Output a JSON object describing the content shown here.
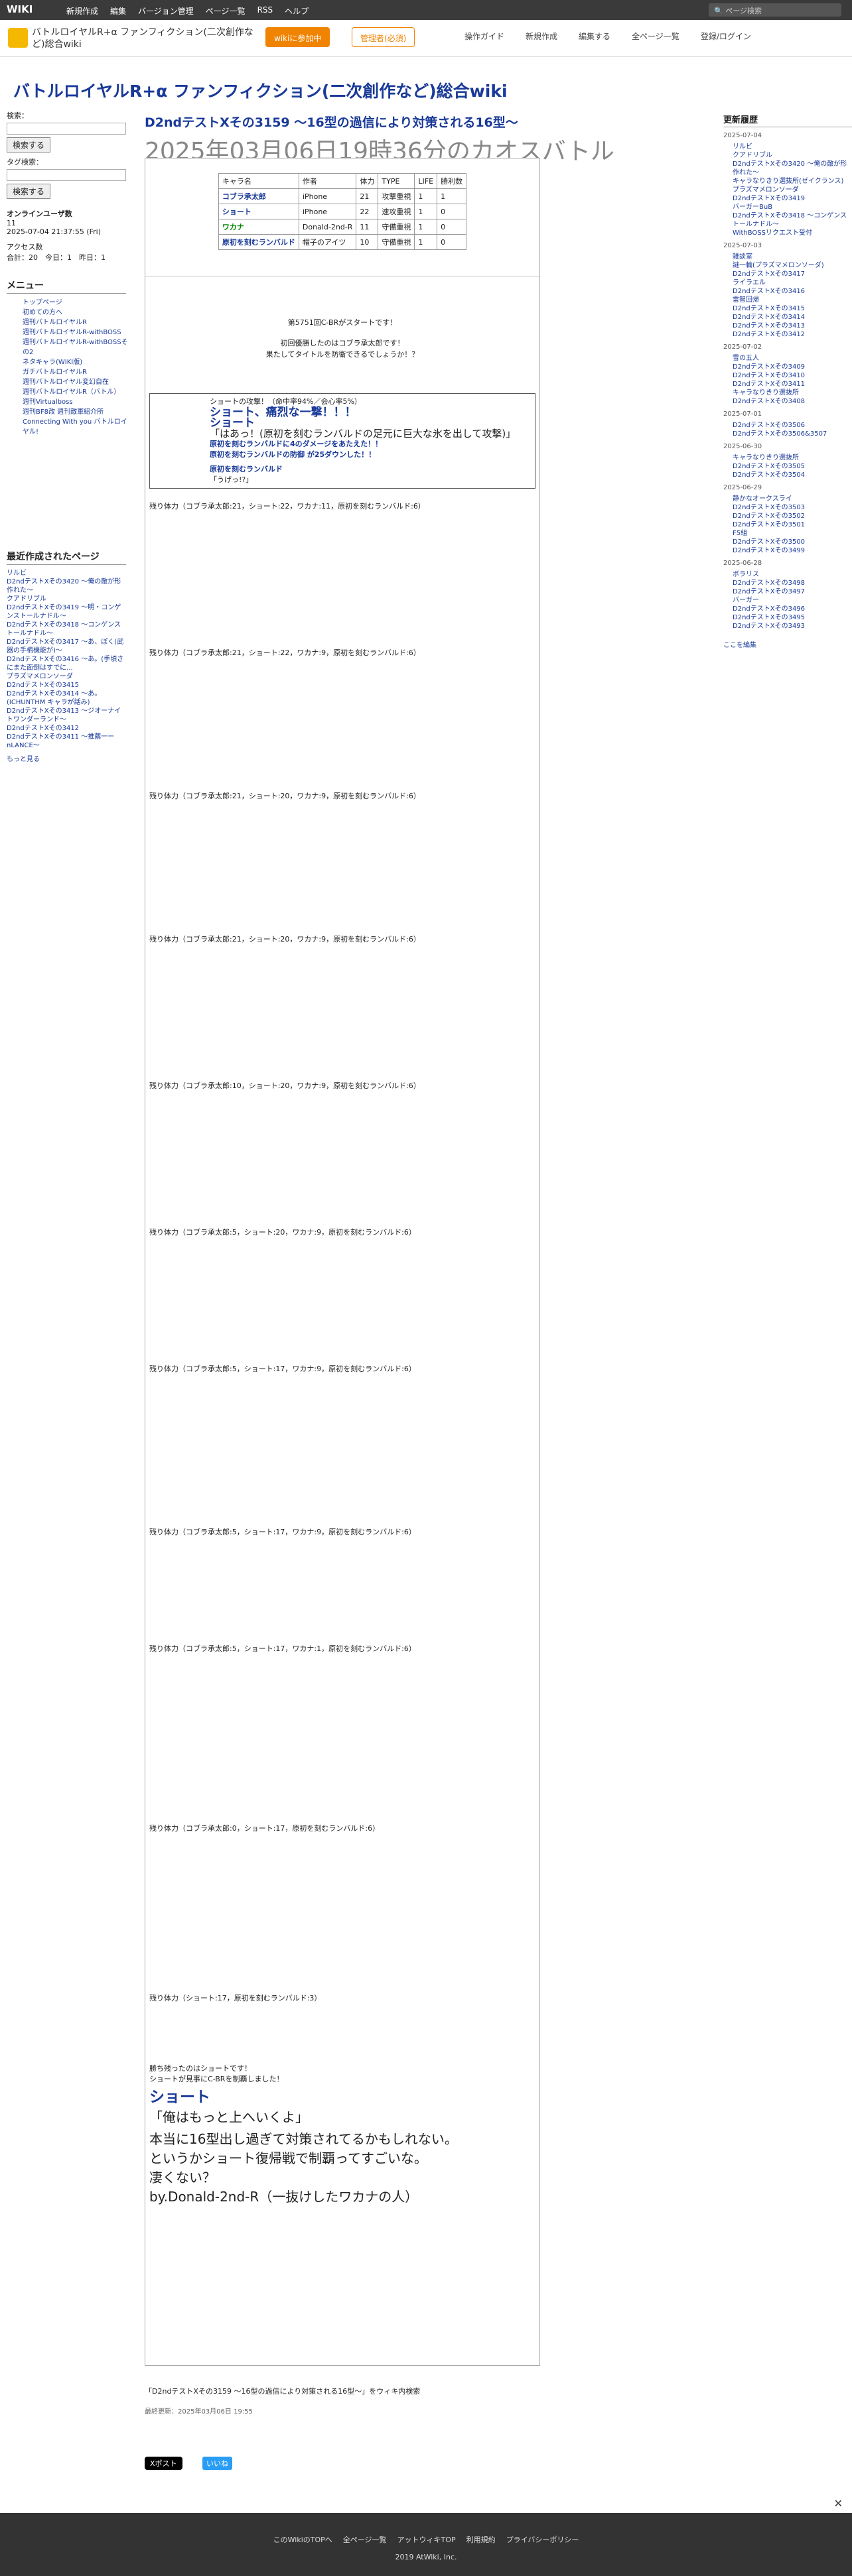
{
  "topbar": {
    "logo": "WIKI",
    "menu": [
      "新規作成",
      "編集",
      "バージョン管理",
      "ページ一覧",
      "RSS",
      "ヘルプ"
    ],
    "search_placeholder": "ページ検索"
  },
  "header": {
    "site_title": "バトルロイヤルR+α ファンフィクション(二次創作など)総合wiki",
    "btn1": "wikiに参加中",
    "btn2": "管理者(必須)",
    "icons": [
      "操作ガイド",
      "新規作成",
      "編集する",
      "全ページ一覧",
      "登録/ログイン"
    ]
  },
  "page_title": "バトルロイヤルR+α ファンフィクション(二次創作など)総合wiki",
  "left": {
    "search_label": "検索：",
    "search_btn": "検索する",
    "tag_label": "タグ検索：",
    "tag_btn": "検索する",
    "online": "オンラインユーザ数",
    "online_count": "11",
    "time": "2025-07-04 21:37:55 (Fri)",
    "access": "アクセス数",
    "access_vals": "合計：20　今日：1　昨日：1",
    "menu_title": "メニュー",
    "recent_title": "最近作成されたページ",
    "more": "もっと見る",
    "menu_items": [
      "トップページ",
      "初めての方へ",
      "週刊バトルロイヤルR",
      "週刊バトルロイヤルR-withBOSS",
      "週刊バトルロイヤルR-withBOSSその2",
      "ネタキャラ(WIKI版)",
      "ガチバトルロイヤルR",
      "週刊バトルロイヤル変幻自在",
      "週刊バトルロイヤルR（バトル）",
      "週刊Virtualboss",
      "週刊BF8改 週刊敵軍紹介所",
      "Connecting With you バトルロイヤル!"
    ],
    "recent": [
      "リルビ",
      "D2ndテストXその3420 ～俺の敵が形作れた～",
      "クアドリブル",
      "D2ndテストXその3419 ～明・コンゲンストールナドル～",
      "D2ndテストXその3418 ～コンゲンストールナドル～",
      "D2ndテストXその3417 ～あ、ぽく(武器の手柄機能が)～",
      "D2ndテストXその3416 ～あ。(手頃さにまた面倒はすでに...",
      "プラズマメロンソーダ",
      "D2ndテストXその3415",
      "D2ndテストXその3414 ～あ。(ICHUNTHM キャラが話み)",
      "D2ndテストXその3413 ～ジオーナイトワンダーランド～",
      "D2ndテストXその3412",
      "D2ndテストXその3411 ～推薦一ーnLANCE～"
    ]
  },
  "main": {
    "h2": "D2ndテストXその3159 ～16型の過信により対策される16型～",
    "date": "2025年03月06日19時36分のカオスバトル"
  },
  "table": {
    "headers": [
      "キャラ名",
      "作者",
      "体力",
      "TYPE",
      "LIFE",
      "勝利数"
    ],
    "rows": [
      [
        "コブラ承太郎",
        "iPhone",
        "21",
        "攻撃重視",
        "1",
        "1"
      ],
      [
        "ショート",
        "iPhone",
        "22",
        "速攻重視",
        "1",
        "0"
      ],
      [
        "ワカナ",
        "Donald-2nd-R",
        "11",
        "守備重視",
        "1",
        "0"
      ],
      [
        "原初を刻むランバルド",
        "帽子のアイツ",
        "10",
        "守備重視",
        "1",
        "0"
      ]
    ]
  },
  "story": {
    "start_count": "第5751回C-BRがスタートです！",
    "start1": "初回優勝したのはコブラ承太郎です！",
    "start2": "果たしてタイトルを防衛できるでしょうか！？",
    "t1_attack": "ショートの攻撃！（命中率94%／会心率5%）",
    "t1_big": "ショート、痛烈な一撃！！！",
    "t1_name": "ショート",
    "t1_line": "「はあっ！(原初を刻むランバルドの足元に巨大な氷を出して攻撃)」",
    "t1_dmg": "原初を刻むランバルドに4のダメージをあたえた！！",
    "t1_dmg2": "原初を刻むランバルドの防御 が25ダウンした！！",
    "t1_rname": "原初を刻むランバルド",
    "t1_rline": "「うげっ!?」",
    "hp1": "残り体力（コブラ承太郎:21，ショート:22，ワカナ:11，原初を刻むランバルド:6）",
    "last_win": "勝ち残ったのはショートです！",
    "last_rank": "ショートが見事にC-BRを制覇しました！",
    "last_name": "ショート",
    "last_line": "「俺はもっと上へいくよ」",
    "c1": "本当に16型出し過ぎて対策されてるかもしれない。",
    "c2": "というかショート復帰戦で制覇ってすごいな。",
    "c3": "凄くない？",
    "c4": "by.Donald-2nd-R（一抜けしたワカナの人）"
  },
  "hp_lines": [
    "残り体力（コブラ承太郎:21，ショート:22，ワカナ:9，原初を刻むランバルド:6）",
    "残り体力（コブラ承太郎:21，ショート:20，ワカナ:9，原初を刻むランバルド:6）",
    "残り体力（コブラ承太郎:21，ショート:20，ワカナ:9，原初を刻むランバルド:6）",
    "残り体力（コブラ承太郎:10，ショート:20，ワカナ:9，原初を刻むランバルド:6）",
    "残り体力（コブラ承太郎:5，ショート:20，ワカナ:9，原初を刻むランバルド:6）",
    "残り体力（コブラ承太郎:5，ショート:17，ワカナ:9，原初を刻むランバルド:6）",
    "残り体力（コブラ承太郎:5，ショート:17，ワカナ:9，原初を刻むランバルド:6）",
    "残り体力（コブラ承太郎:5，ショート:17，ワカナ:1，原初を刻むランバルド:6）",
    "残り体力（コブラ承太郎:0，ショート:17，原初を刻むランバルド:6）",
    "残り体力（ショート:17，原初を刻むランバルド:3）"
  ],
  "bottom": {
    "tweet": "Xポスト",
    "like": "いいね",
    "link": "「D2ndテストXその3159 ～16型の過信により対策される16型～」をウィキ内検索",
    "updated": "最終更新：2025年03月06日 19:55"
  },
  "right": {
    "title": "更新履歴",
    "groups": [
      {
        "date": "2025-07-04",
        "items": [
          "リルビ",
          "クアドリブル",
          "D2ndテストXその3420 ～俺の敵が形作れた～",
          "キャラなりきり選抜所(ゼイクランス)",
          "プラズマメロンソーダ",
          "D2ndテストXその3419",
          "バーガーBuB",
          "D2ndテストXその3418 ～コンゲンストールナドル～",
          "WithBOSSリクエスト受付"
        ]
      },
      {
        "date": "2025-07-03",
        "items": [
          "雑談室",
          "謎一輪(プラズマメロンソーダ)",
          "D2ndテストXその3417",
          "ライラエル",
          "D2ndテストXその3416",
          "雷智回帰",
          "D2ndテストXその3415",
          "D2ndテストXその3414",
          "D2ndテストXその3413",
          "D2ndテストXその3412"
        ]
      },
      {
        "date": "2025-07-02",
        "items": [
          "雪の五人",
          "D2ndテストXその3409",
          "D2ndテストXその3410",
          "D2ndテストXその3411",
          "キャラなりきり選抜所",
          "D2ndテストXその3408"
        ]
      },
      {
        "date": "2025-07-01",
        "items": [
          "D2ndテストXその3506",
          "D2ndテストXその3506&3507"
        ]
      },
      {
        "date": "2025-06-30",
        "items": [
          "キャラなりきり選抜所",
          "D2ndテストXその3505",
          "D2ndテストXその3504"
        ]
      },
      {
        "date": "2025-06-29",
        "items": [
          "静かなオークスライ",
          "D2ndテストXその3503",
          "D2ndテストXその3502",
          "D2ndテストXその3501",
          "F5組",
          "D2ndテストXその3500",
          "D2ndテストXその3499"
        ]
      },
      {
        "date": "2025-06-28",
        "items": [
          "ボラリス",
          "D2ndテストXその3498",
          "D2ndテストXその3497",
          "バーガー",
          "D2ndテストXその3496",
          "D2ndテストXその3495",
          "D2ndテストXその3493"
        ]
      }
    ],
    "edit": "ここを編集"
  },
  "footer": {
    "links": [
      "このWikiのTOPへ",
      "全ページ一覧",
      "アットウィキTOP",
      "利用規約",
      "プライバシーポリシー"
    ],
    "copy": "2019 AtWiki, Inc."
  }
}
